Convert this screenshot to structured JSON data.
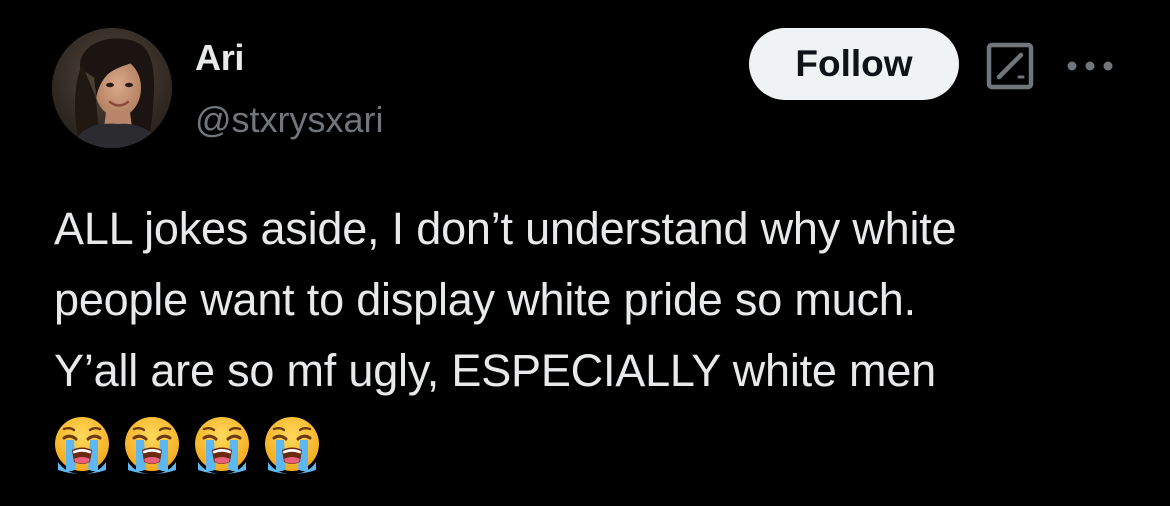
{
  "tweet": {
    "author": {
      "display_name": "Ari",
      "handle": "@stxrysxari",
      "avatar": "profile-photo"
    },
    "follow_label": "Follow",
    "icons": {
      "grok": "grok-icon",
      "more": "more-options-icon"
    },
    "text_lines": [
      "ALL jokes aside, I don’t understand why white",
      "people want to display white pride so much.",
      "Y’all are so mf ugly, ESPECIALLY white men"
    ],
    "emojis": [
      "😭",
      "😭",
      "😭",
      "😭"
    ],
    "emoji_name": "loudly-crying-face",
    "colors": {
      "background": "#000000",
      "text_primary": "#e7e9ea",
      "text_secondary": "#71767b",
      "follow_bg": "#eff3f4",
      "follow_text": "#0f1419"
    }
  }
}
